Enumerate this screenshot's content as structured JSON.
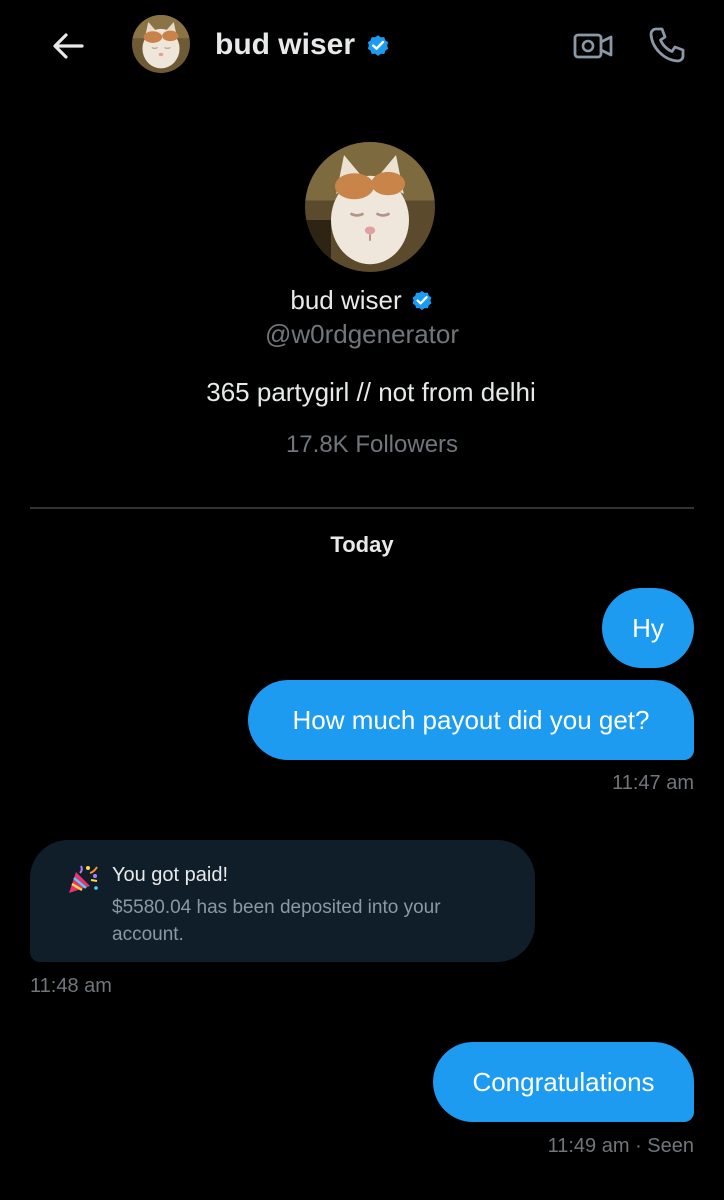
{
  "header": {
    "name": "bud wiser",
    "back_icon": "arrow-left-icon",
    "video_icon": "video-call-icon",
    "phone_icon": "phone-call-icon",
    "verified_icon": "verified-badge-icon",
    "accent_color": "#1d9bf0"
  },
  "profile": {
    "name": "bud wiser",
    "handle": "@w0rdgenerator",
    "bio": "365 partygirl // not from delhi",
    "followers": "17.8K Followers"
  },
  "conversation": {
    "date_separator": "Today",
    "messages": [
      {
        "direction": "outgoing",
        "text": "Hy"
      },
      {
        "direction": "outgoing",
        "text": "How much payout did you get?",
        "time": "11:47 am"
      },
      {
        "direction": "incoming",
        "type": "payment-card",
        "title": "You got paid!",
        "body": "$5580.04 has been deposited into your account.",
        "time": "11:48 am",
        "icon": "party-popper-icon"
      },
      {
        "direction": "outgoing",
        "text": "Congratulations",
        "time": "11:49 am · Seen"
      }
    ]
  },
  "colors": {
    "background": "#000000",
    "outgoing_bubble": "#1d9bf0",
    "incoming_bubble": "#0f1e28",
    "muted_text": "#71767b"
  }
}
